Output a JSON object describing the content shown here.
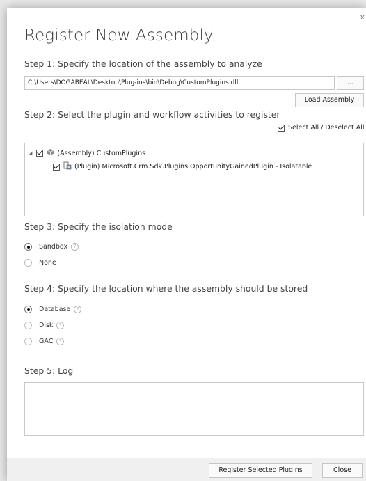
{
  "dialog": {
    "title": "Register New Assembly",
    "close_glyph": "x"
  },
  "step1": {
    "label": "Step 1: Specify the location of the assembly to analyze",
    "path_value": "C:\\Users\\DOGABEAL\\Desktop\\Plug-ins\\bin\\Debug\\CustomPlugins.dll",
    "browse_label": "...",
    "load_label": "Load Assembly"
  },
  "step2": {
    "label": "Step 2: Select the plugin and workflow activities to register",
    "select_all_label": "Select All / Deselect All",
    "select_all_checked": true,
    "tree": [
      {
        "label": "(Assembly) CustomPlugins",
        "checked": true,
        "icon": "assembly-icon",
        "expanded": true
      },
      {
        "label": "(Plugin) Microsoft.Crm.Sdk.Plugins.OpportunityGainedPlugin - Isolatable",
        "checked": true,
        "icon": "plugin-icon"
      }
    ]
  },
  "step3": {
    "label": "Step 3: Specify the isolation mode",
    "options": [
      {
        "label": "Sandbox",
        "selected": true,
        "help": true
      },
      {
        "label": "None",
        "selected": false,
        "help": false
      }
    ]
  },
  "step4": {
    "label": "Step 4: Specify the location where the assembly should be stored",
    "options": [
      {
        "label": "Database",
        "selected": true
      },
      {
        "label": "Disk",
        "selected": false
      },
      {
        "label": "GAC",
        "selected": false
      }
    ]
  },
  "step5": {
    "label": "Step 5: Log",
    "log_text": ""
  },
  "footer": {
    "register_label": "Register Selected Plugins",
    "close_label": "Close"
  },
  "help_glyph": "?",
  "colors": {
    "dialog_bg": "#ffffff",
    "footer_bg": "#f0f0f0",
    "border": "#c8c8c8"
  }
}
